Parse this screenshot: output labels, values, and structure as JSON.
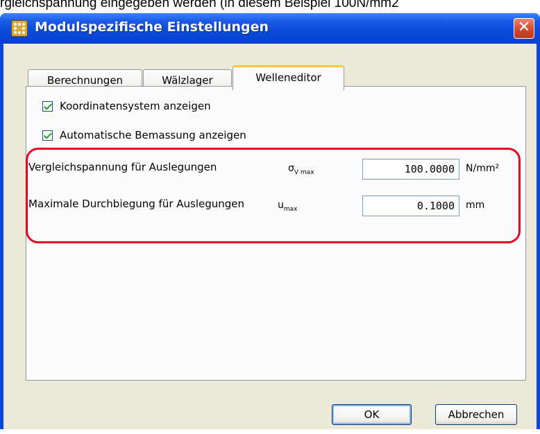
{
  "background_caption": "rgleichspannung eingegeben werden (in diesem Beispiel 100N/mm2",
  "window": {
    "title": "Modulspezifische Einstellungen",
    "close_symbol": "✕"
  },
  "tabs": [
    {
      "label": "Berechnungen",
      "active": false
    },
    {
      "label": "Wälzlager",
      "active": false
    },
    {
      "label": "Welleneditor",
      "active": true
    }
  ],
  "checkboxes": [
    {
      "label": "Koordinatensystem anzeigen",
      "checked": true
    },
    {
      "label": "Automatische Bemassung anzeigen",
      "checked": true
    }
  ],
  "fields": [
    {
      "label": "Vergleichspannung für Auslegungen",
      "symbol": "σ",
      "symbol_sub": "V max",
      "value": "100.0000",
      "unit": "N/mm²"
    },
    {
      "label": "Maximale Durchbiegung für Auslegungen",
      "symbol": "u",
      "symbol_sub": "max",
      "value": "0.1000",
      "unit": "mm"
    }
  ],
  "buttons": {
    "ok": "OK",
    "cancel": "Abbrechen"
  },
  "colors": {
    "titlebar": "#0a49d8",
    "dialog_bg": "#ece9d8",
    "highlight": "#e8001e",
    "active_tab_accent": "#ffc83c",
    "checkmark": "#21a121"
  },
  "icons": {
    "app": "settings-dots-icon",
    "close": "close-icon",
    "checkbox": "checkmark-icon"
  }
}
